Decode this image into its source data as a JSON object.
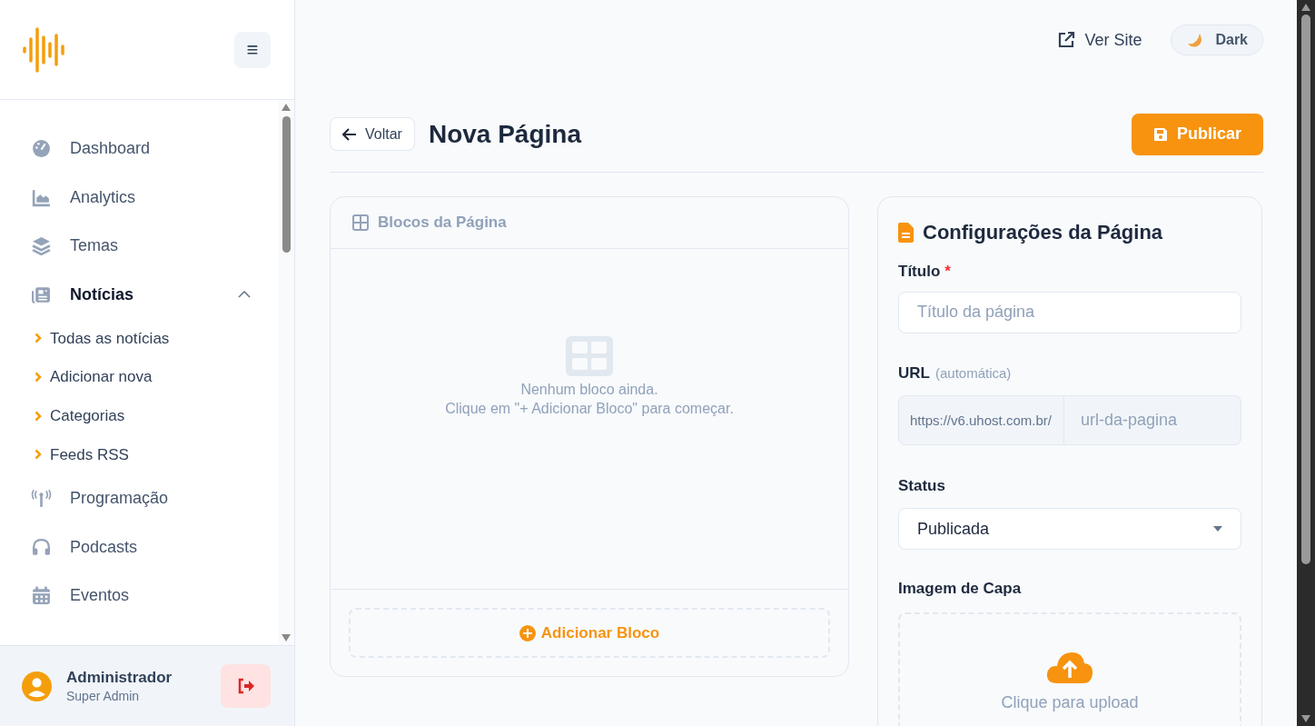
{
  "sidebar": {
    "menu_button": "≡",
    "items": [
      {
        "label": "Dashboard",
        "selected": false
      },
      {
        "label": "Analytics",
        "selected": false
      },
      {
        "label": "Temas",
        "selected": false
      },
      {
        "label": "Notícias",
        "selected": true,
        "expanded": true,
        "children": [
          {
            "label": "Todas as notícias"
          },
          {
            "label": "Adicionar nova"
          },
          {
            "label": "Categorias"
          },
          {
            "label": "Feeds RSS"
          }
        ]
      },
      {
        "label": "Programação",
        "selected": false
      },
      {
        "label": "Podcasts",
        "selected": false
      },
      {
        "label": "Eventos",
        "selected": false
      }
    ],
    "user": {
      "name": "Administrador",
      "role": "Super Admin"
    }
  },
  "topbar": {
    "view_site": "Ver Site",
    "theme_toggle": "Dark"
  },
  "header": {
    "back": "Voltar",
    "title": "Nova Página",
    "publish": "Publicar"
  },
  "blocks_panel": {
    "title": "Blocos da Página",
    "empty_lines": [
      "Nenhum bloco ainda.",
      "Clique em \"+ Adicionar Bloco\" para começar."
    ],
    "add_button": "Adicionar Bloco"
  },
  "settings_panel": {
    "title": "Configurações da Página",
    "title_field": {
      "label": "Título",
      "required_mark": "*",
      "placeholder": "Título da página"
    },
    "url_field": {
      "label": "URL",
      "hint": "(automática)",
      "prefix": "https://v6.uhost.com.br/",
      "placeholder": "url-da-pagina"
    },
    "status_field": {
      "label": "Status",
      "value": "Publicada"
    },
    "cover": {
      "label": "Imagem de Capa",
      "upload_text": "Clique para upload"
    }
  }
}
